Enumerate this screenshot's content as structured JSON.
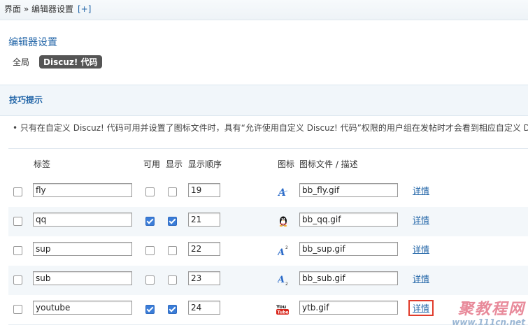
{
  "breadcrumb": {
    "text": "界面 » 编辑器设置",
    "plus": "[+]"
  },
  "page_title": "编辑器设置",
  "subnav": {
    "tab_global": "全局",
    "tab_discuz": "Discuz! 代码"
  },
  "tips": {
    "title": "技巧提示",
    "line": "• 只有在自定义 Discuz! 代码可用并设置了图标文件时，具有“允许使用自定义 Discuz! 代码”权限的用户组在发帖时才会看到相应自定义 D"
  },
  "table": {
    "headers": {
      "tag": "标签",
      "available": "可用",
      "display": "显示",
      "order": "显示顺序",
      "icon": "图标",
      "icon_file": "图标文件 / 描述"
    },
    "detail_label": "详情",
    "rows": [
      {
        "tag": "fly",
        "available": false,
        "display": false,
        "order": "19",
        "icon": "fly-icon",
        "file": "bb_fly.gif"
      },
      {
        "tag": "qq",
        "available": true,
        "display": true,
        "order": "21",
        "icon": "qq-penguin-icon",
        "file": "bb_qq.gif"
      },
      {
        "tag": "sup",
        "available": false,
        "display": false,
        "order": "22",
        "icon": "superscript-icon",
        "file": "bb_sup.gif"
      },
      {
        "tag": "sub",
        "available": false,
        "display": false,
        "order": "23",
        "icon": "subscript-icon",
        "file": "bb_sub.gif"
      },
      {
        "tag": "youtube",
        "available": true,
        "display": true,
        "order": "24",
        "icon": "youtube-icon",
        "file": "ytb.gif"
      }
    ]
  },
  "watermark": {
    "line1": "聚教程网",
    "line2": "www.111cn.net"
  },
  "colors": {
    "link": "#2366a8",
    "highlight": "#e03c2c",
    "checkbox_on": "#3b7dd8"
  }
}
